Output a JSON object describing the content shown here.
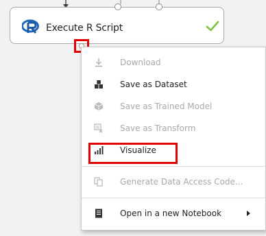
{
  "module": {
    "title": "Execute R Script",
    "status_icon": "check-icon",
    "logo_icon": "r-logo-icon"
  },
  "context_menu": {
    "items": [
      {
        "label": "Download",
        "icon": "download-icon",
        "enabled": false
      },
      {
        "label": "Save as Dataset",
        "icon": "dataset-icon",
        "enabled": true
      },
      {
        "label": "Save as Trained Model",
        "icon": "trained-model-icon",
        "enabled": false
      },
      {
        "label": "Save as Transform",
        "icon": "transform-icon",
        "enabled": false
      },
      {
        "label": "Visualize",
        "icon": "visualize-icon",
        "enabled": true
      },
      {
        "label": "Generate Data Access Code...",
        "icon": "copy-code-icon",
        "enabled": false
      },
      {
        "label": "Open in a new Notebook",
        "icon": "notebook-icon",
        "enabled": true,
        "has_submenu": true
      }
    ]
  },
  "colors": {
    "highlight": "#e00000",
    "check": "#7cc242",
    "r_logo": "#2266b8",
    "disabled_text": "#a9a9a9"
  }
}
